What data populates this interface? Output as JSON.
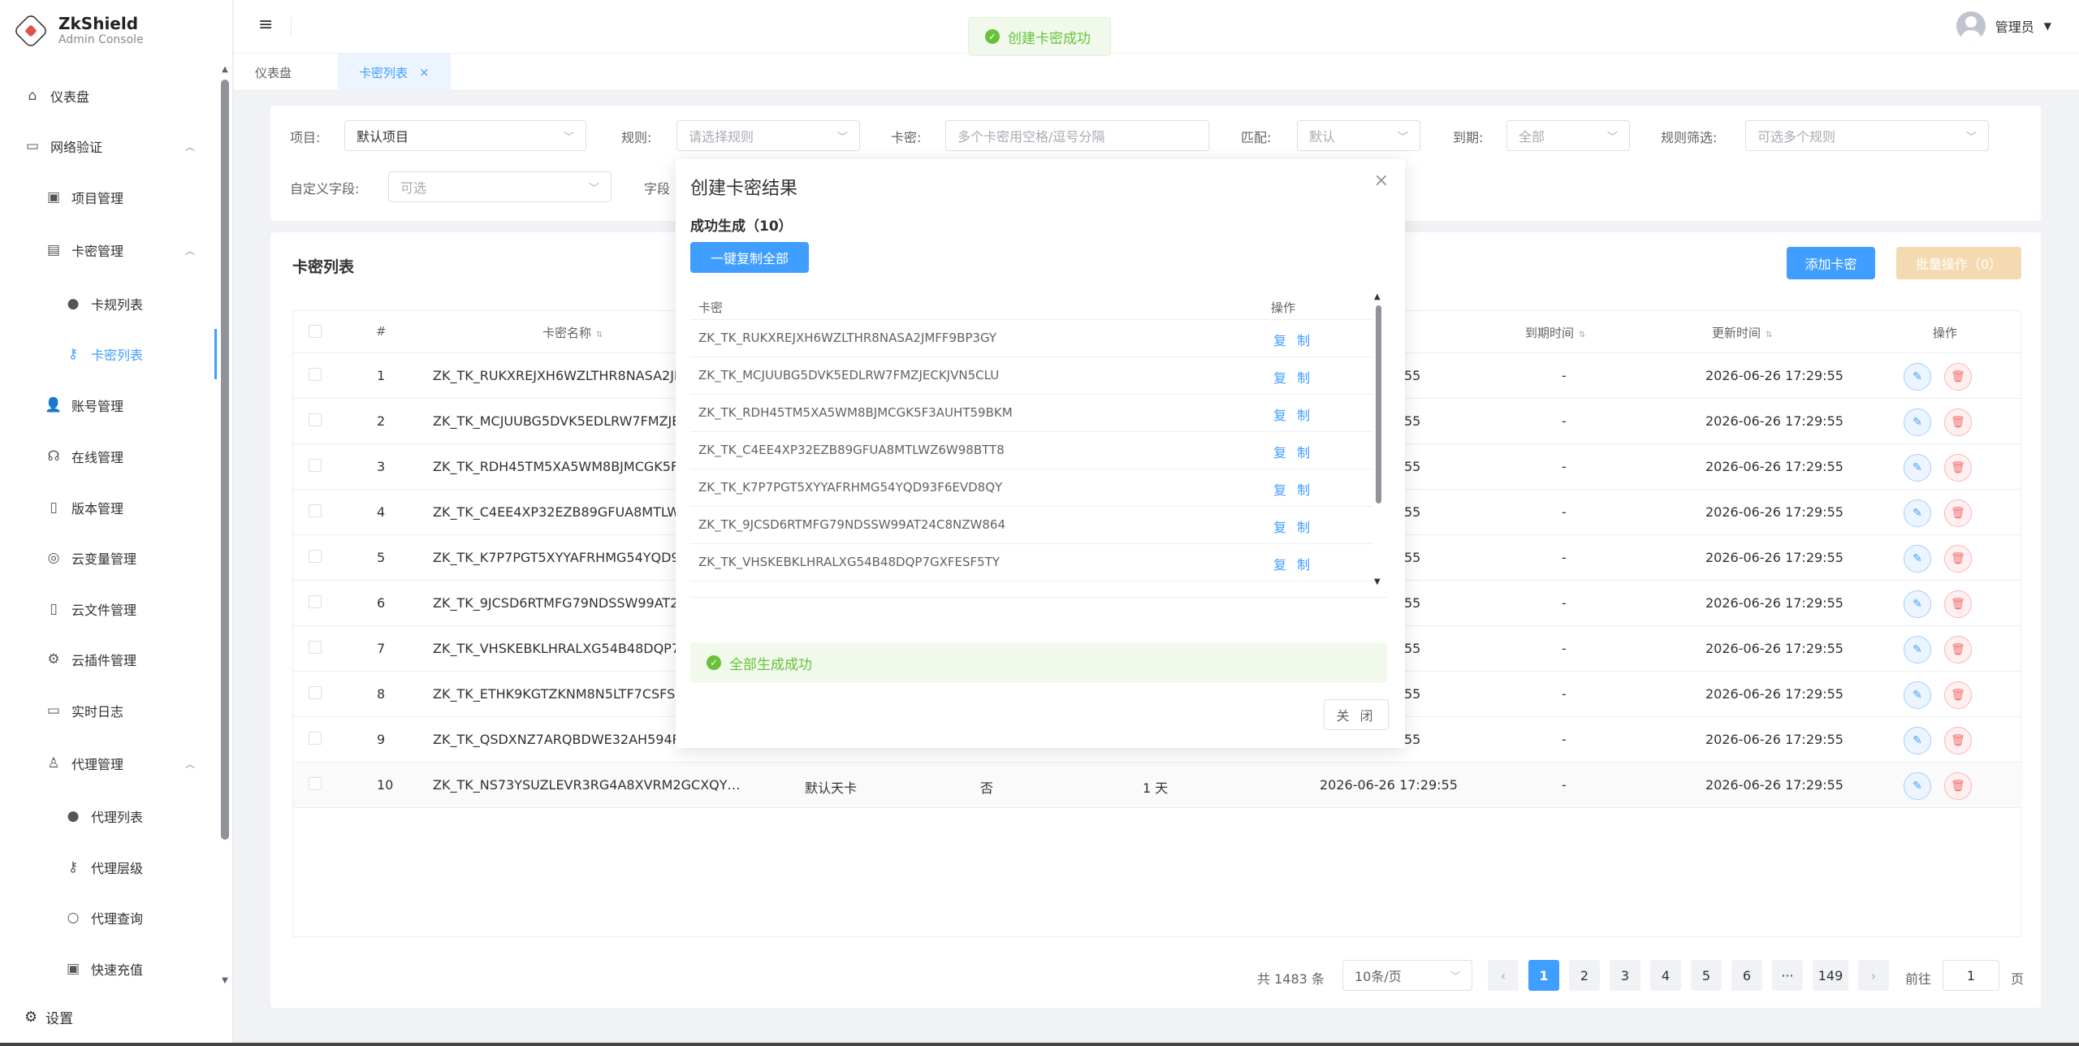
{
  "brand": {
    "title": "ZkShield",
    "subtitle": "Admin Console"
  },
  "sidebar": {
    "items": [
      {
        "label": "仪表盘",
        "icon": "home-icon"
      },
      {
        "label": "网络验证",
        "icon": "folder-icon",
        "expanded": true
      },
      {
        "label": "项目管理",
        "icon": "briefcase-icon"
      },
      {
        "label": "卡密管理",
        "icon": "card-icon",
        "expanded": true
      },
      {
        "label": "卡规列表",
        "icon": "tag-icon"
      },
      {
        "label": "卡密列表",
        "icon": "key-icon",
        "active": true
      },
      {
        "label": "账号管理",
        "icon": "user-icon"
      },
      {
        "label": "在线管理",
        "icon": "headset-icon"
      },
      {
        "label": "版本管理",
        "icon": "document-icon"
      },
      {
        "label": "云变量管理",
        "icon": "coins-icon"
      },
      {
        "label": "云文件管理",
        "icon": "file-icon"
      },
      {
        "label": "云插件管理",
        "icon": "chip-icon"
      },
      {
        "label": "实时日志",
        "icon": "monitor-icon"
      },
      {
        "label": "代理管理",
        "icon": "agent-icon",
        "expanded": true
      },
      {
        "label": "代理列表",
        "icon": "tag-icon"
      },
      {
        "label": "代理层级",
        "icon": "key-icon"
      },
      {
        "label": "代理查询",
        "icon": "search-icon"
      },
      {
        "label": "快速充值",
        "icon": "wallet-icon"
      }
    ],
    "settings_label": "设置"
  },
  "header": {
    "user_name": "管理员"
  },
  "tabs": [
    {
      "label": "仪表盘"
    },
    {
      "label": "卡密列表",
      "active": true
    }
  ],
  "toast": {
    "message": "创建卡密成功"
  },
  "filters": {
    "project_label": "项目:",
    "project_value": "默认项目",
    "rule_label": "规则:",
    "rule_placeholder": "请选择规则",
    "card_label": "卡密:",
    "card_placeholder": "多个卡密用空格/逗号分隔",
    "match_label": "匹配:",
    "match_placeholder": "默认",
    "expire_label": "到期:",
    "expire_placeholder": "全部",
    "rule_filter_label": "规则筛选:",
    "rule_filter_placeholder": "可选多个规则",
    "custom_field_label": "自定义字段:",
    "custom_field_placeholder": "可选",
    "field_label_partial": "字段"
  },
  "card_list": {
    "title": "卡密列表",
    "add_button": "添加卡密",
    "batch_button": "批量操作（0）",
    "columns": {
      "index": "#",
      "name": "卡密名称",
      "expire_time": "到期时间",
      "update_time": "更新时间",
      "actions": "操作"
    },
    "rows": [
      {
        "index": "1",
        "code": "ZK_TK_RUKXREJXH6WZLTHR8NASA2JM",
        "created_tail": "55",
        "expire": "-",
        "updated": "2026-06-26 17:29:55"
      },
      {
        "index": "2",
        "code": "ZK_TK_MCJUUBG5DVK5EDLRW7FMZJE",
        "created_tail": "55",
        "expire": "-",
        "updated": "2026-06-26 17:29:55"
      },
      {
        "index": "3",
        "code": "ZK_TK_RDH45TM5XA5WM8BJMCGK5F3",
        "created_tail": "55",
        "expire": "-",
        "updated": "2026-06-26 17:29:55"
      },
      {
        "index": "4",
        "code": "ZK_TK_C4EE4XP32EZB89GFUA8MTLWZ",
        "created_tail": "55",
        "expire": "-",
        "updated": "2026-06-26 17:29:55"
      },
      {
        "index": "5",
        "code": "ZK_TK_K7P7PGT5XYYAFRHMG54YQD93",
        "created_tail": "55",
        "expire": "-",
        "updated": "2026-06-26 17:29:55"
      },
      {
        "index": "6",
        "code": "ZK_TK_9JCSD6RTMFG79NDSSW99AT24",
        "created_tail": "55",
        "expire": "-",
        "updated": "2026-06-26 17:29:55"
      },
      {
        "index": "7",
        "code": "ZK_TK_VHSKEBKLHRALXG54B48DQP7G",
        "created_tail": "55",
        "expire": "-",
        "updated": "2026-06-26 17:29:55"
      },
      {
        "index": "8",
        "code": "ZK_TK_ETHK9KGTZKNM8N5LTF7CSFS4",
        "created_tail": "55",
        "expire": "-",
        "updated": "2026-06-26 17:29:55"
      },
      {
        "index": "9",
        "code": "ZK_TK_QSDXNZ7ARQBDWE32AH594RR",
        "created_tail": "55",
        "expire": "-",
        "updated": "2026-06-26 17:29:55"
      },
      {
        "index": "10",
        "code": "ZK_TK_NS73YSUZLEVR3RG4A8XVRM2GCXQY…",
        "rule": "默认天卡",
        "flag": "否",
        "duration": "1 天",
        "created": "2026-06-26 17:29:55",
        "expire": "-",
        "updated": "2026-06-26 17:29:55"
      }
    ]
  },
  "pagination": {
    "total": "共 1483 条",
    "page_size": "10条/页",
    "pages": [
      "1",
      "2",
      "3",
      "4",
      "5",
      "6"
    ],
    "ellipsis": "···",
    "last_page": "149",
    "current": "1",
    "goto_label": "前往",
    "goto_value": "1",
    "page_suffix": "页"
  },
  "dialog": {
    "title": "创建卡密结果",
    "success_count": "成功生成（10）",
    "copy_all_button": "一键复制全部",
    "columns": {
      "code": "卡密",
      "action": "操作"
    },
    "copy_label": "复 制",
    "codes": [
      "ZK_TK_RUKXREJXH6WZLTHR8NASA2JMFF9BP3GY",
      "ZK_TK_MCJUUBG5DVK5EDLRW7FMZJECKJVN5CLU",
      "ZK_TK_RDH45TM5XA5WM8BJMCGK5F3AUHT59BKM",
      "ZK_TK_C4EE4XP32EZB89GFUA8MTLWZ6W98BTT8",
      "ZK_TK_K7P7PGT5XYYAFRHMG54YQD93F6EVD8QY",
      "ZK_TK_9JCSD6RTMFG79NDSSW99AT24C8NZW864",
      "ZK_TK_VHSKEBKLHRALXG54B48DQP7GXFESF5TY"
    ],
    "alert": "全部生成成功",
    "close_button": "关 闭"
  },
  "colors": {
    "primary": "#409eff",
    "success": "#67c23a",
    "danger": "#f56c6c",
    "warning_light": "#f5dab1"
  }
}
